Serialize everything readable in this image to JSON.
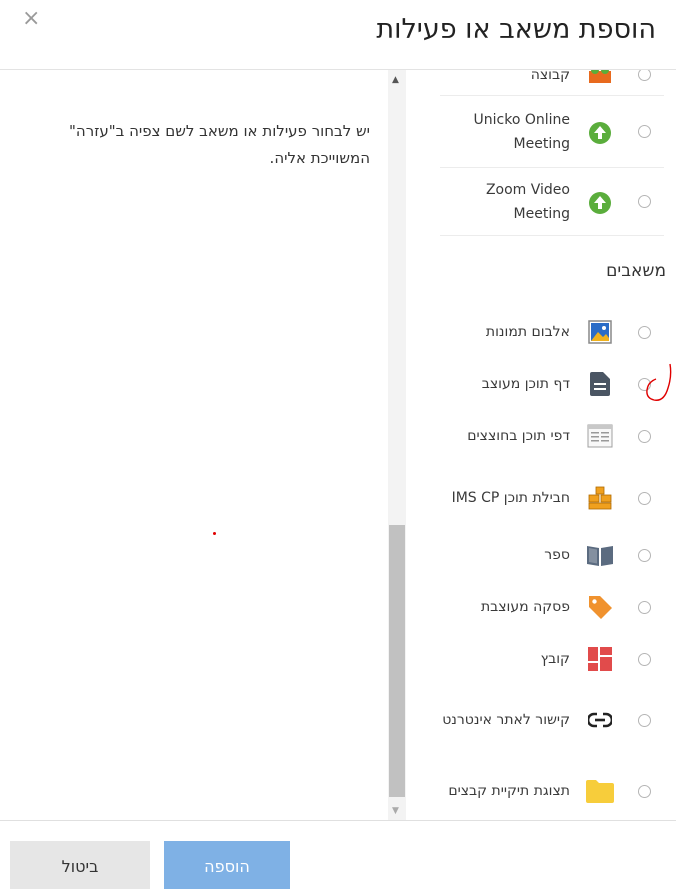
{
  "dialog": {
    "title": "הוספת משאב או פעילות",
    "close_glyph": "×",
    "help_text": "יש לבחור פעילות או משאב לשם צפיה ב\"עזרה\" המשוייכת אליה."
  },
  "activities_partial": [
    {
      "label": "קבוצה",
      "icon": "group-icon",
      "color": "#e86a1e"
    },
    {
      "label": "Unicko Online Meeting",
      "icon": "upload-cloud-icon",
      "color": "#5aad3c"
    },
    {
      "label": "Zoom Video Meeting",
      "icon": "upload-cloud-icon",
      "color": "#5aad3c"
    }
  ],
  "resources_title": "משאבים",
  "resources": [
    {
      "label": "אלבום תמונות",
      "icon": "image-gallery-icon"
    },
    {
      "label": "דף תוכן מעוצב",
      "icon": "document-icon"
    },
    {
      "label": "דפי תוכן בחוצצים",
      "icon": "tabbed-page-icon"
    },
    {
      "label": "חבילת תוכן IMS CP",
      "icon": "package-icon"
    },
    {
      "label": "ספר",
      "icon": "book-icon"
    },
    {
      "label": "פסקה מעוצבת",
      "icon": "tag-icon"
    },
    {
      "label": "קובץ",
      "icon": "file-grid-icon"
    },
    {
      "label": "קישור לאתר אינטרנט",
      "icon": "link-icon"
    },
    {
      "label": "תצוגת תיקיית קבצים",
      "icon": "folder-icon"
    }
  ],
  "footer": {
    "add_label": "הוספה",
    "cancel_label": "ביטול"
  },
  "colors": {
    "primary": "#7fb1e5",
    "cancel_bg": "#e6e6e6",
    "annotation": "#e00000"
  }
}
